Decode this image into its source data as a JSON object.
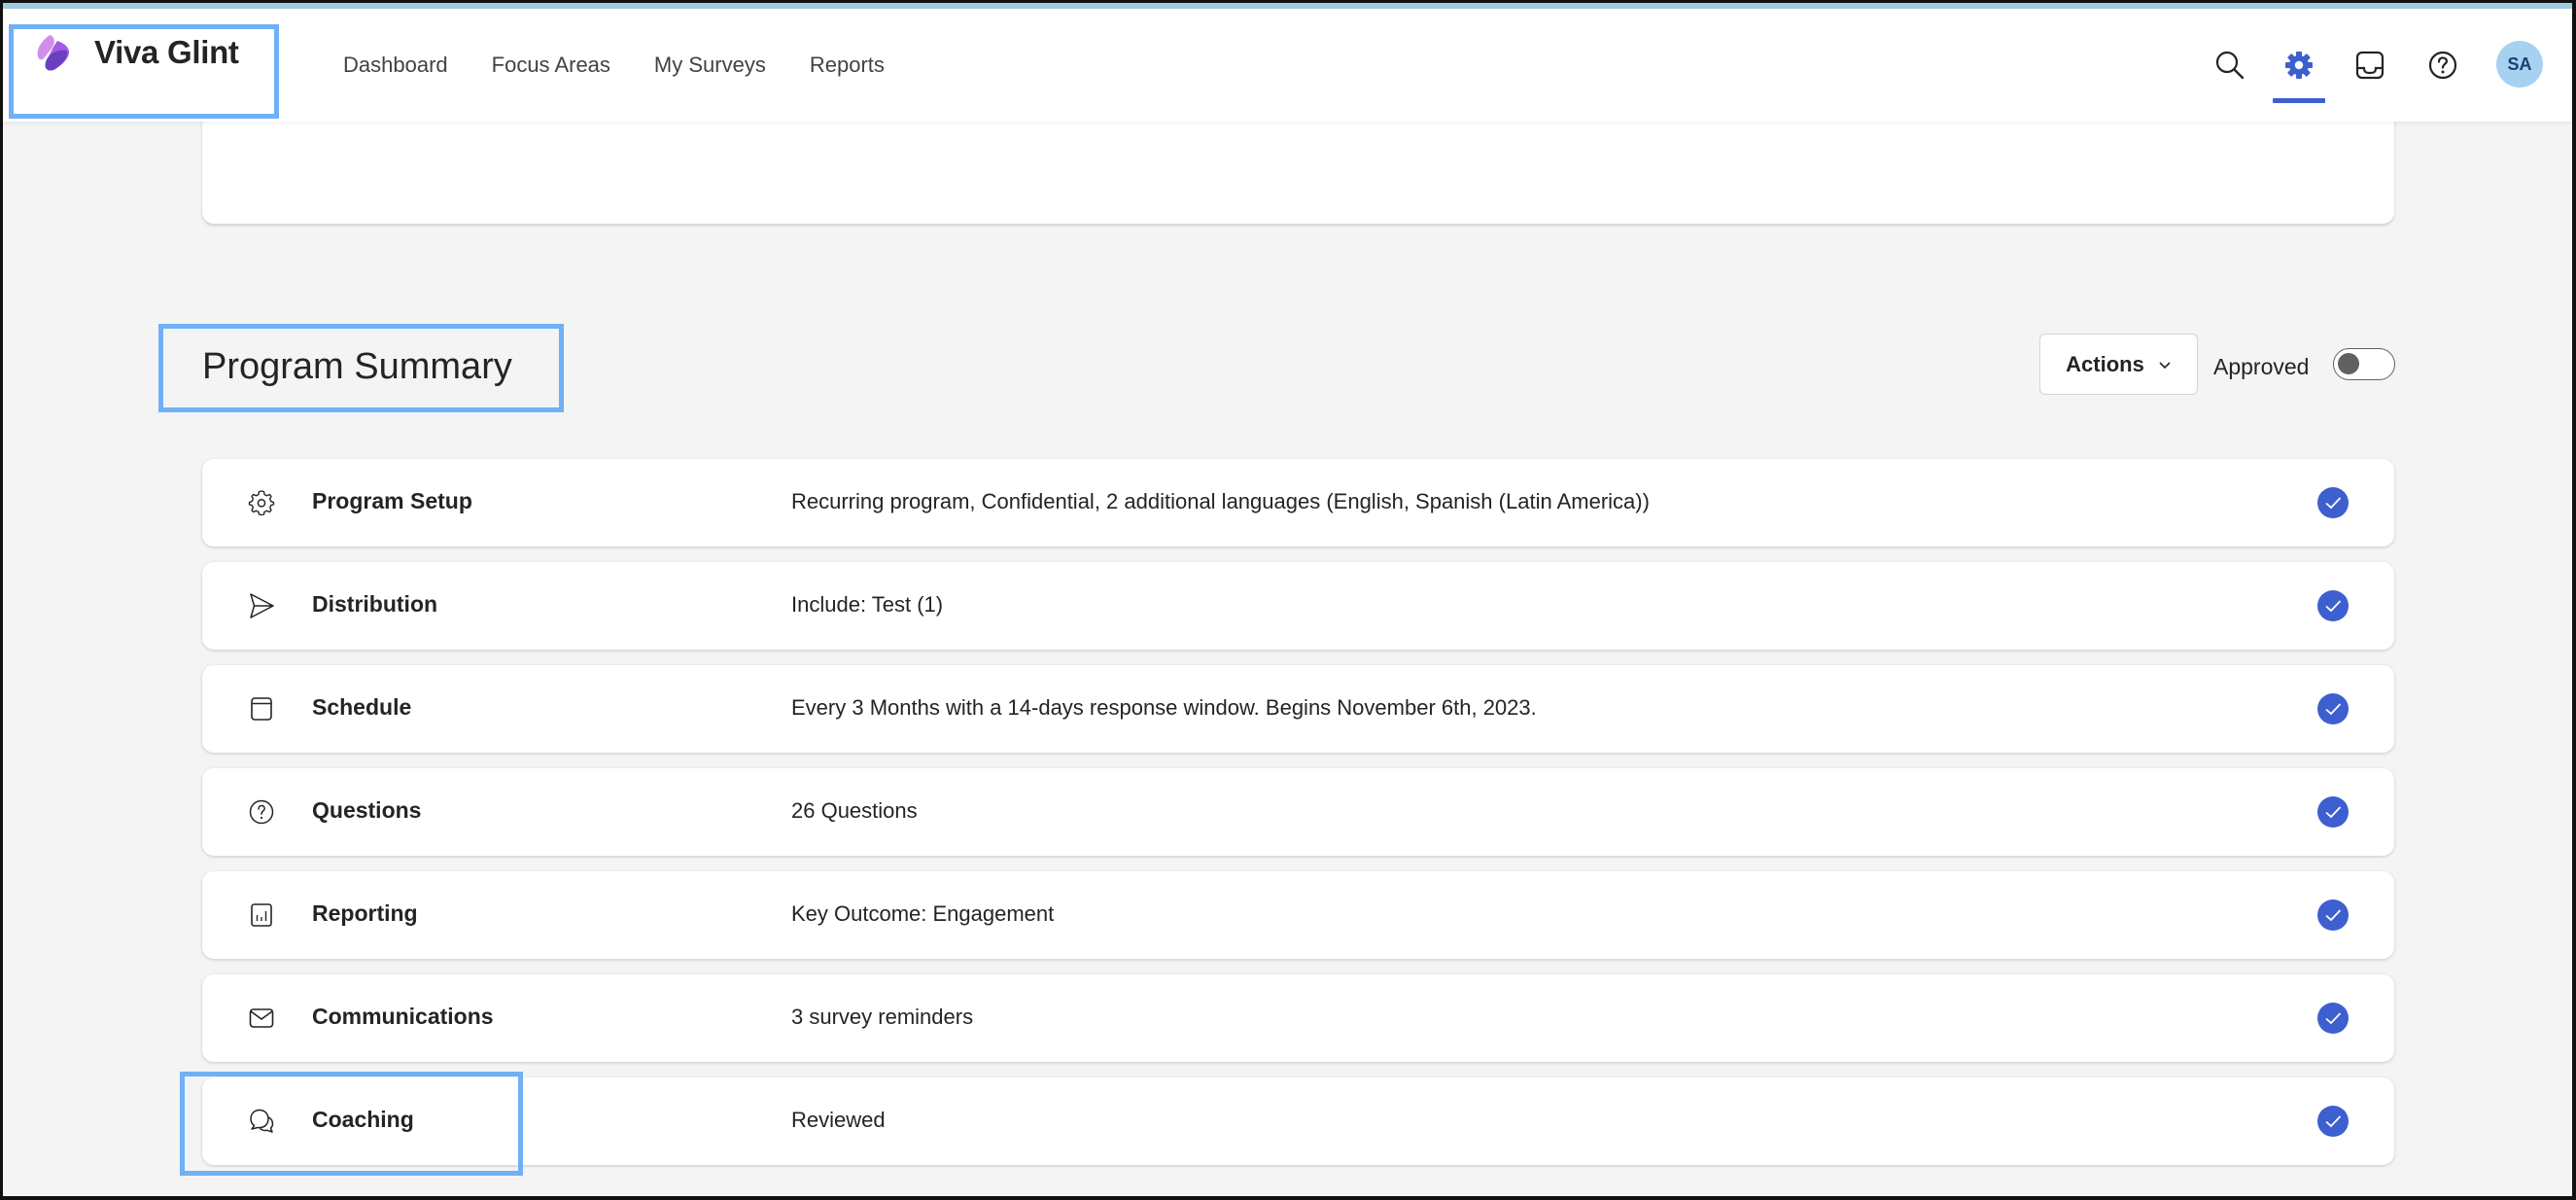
{
  "app": {
    "name": "Viva Glint",
    "logo_icon": "viva-glint-logo-icon"
  },
  "nav": {
    "items": [
      {
        "label": "Dashboard"
      },
      {
        "label": "Focus Areas"
      },
      {
        "label": "My Surveys"
      },
      {
        "label": "Reports"
      }
    ]
  },
  "header_icons": {
    "search": "search-icon",
    "settings": "gear-icon",
    "settings_active": true,
    "inbox": "inbox-icon",
    "help": "help-icon",
    "avatar_initials": "SA"
  },
  "colors": {
    "accent": "#3d5fcf",
    "highlight_border": "#6fb0f7",
    "avatar_bg": "#a7d1f0",
    "page_bg": "#f4f4f4"
  },
  "summary": {
    "title": "Program Summary",
    "actions_label": "Actions",
    "approved_label": "Approved",
    "approved_on": false,
    "rows": [
      {
        "icon": "gear-icon",
        "label": "Program Setup",
        "value": "Recurring program, Confidential, 2 additional languages (English, Spanish (Latin America))",
        "complete": true
      },
      {
        "icon": "send-icon",
        "label": "Distribution",
        "value": "Include: Test (1)",
        "complete": true
      },
      {
        "icon": "calendar-icon",
        "label": "Schedule",
        "value": "Every 3 Months with a 14-days response window. Begins November 6th, 2023.",
        "complete": true
      },
      {
        "icon": "question-circle-icon",
        "label": "Questions",
        "value": "26 Questions",
        "complete": true
      },
      {
        "icon": "chart-icon",
        "label": "Reporting",
        "value": "Key Outcome: Engagement",
        "complete": true
      },
      {
        "icon": "mail-icon",
        "label": "Communications",
        "value": "3 survey reminders",
        "complete": true
      },
      {
        "icon": "chat-icon",
        "label": "Coaching",
        "value": "Reviewed",
        "complete": true
      }
    ]
  }
}
